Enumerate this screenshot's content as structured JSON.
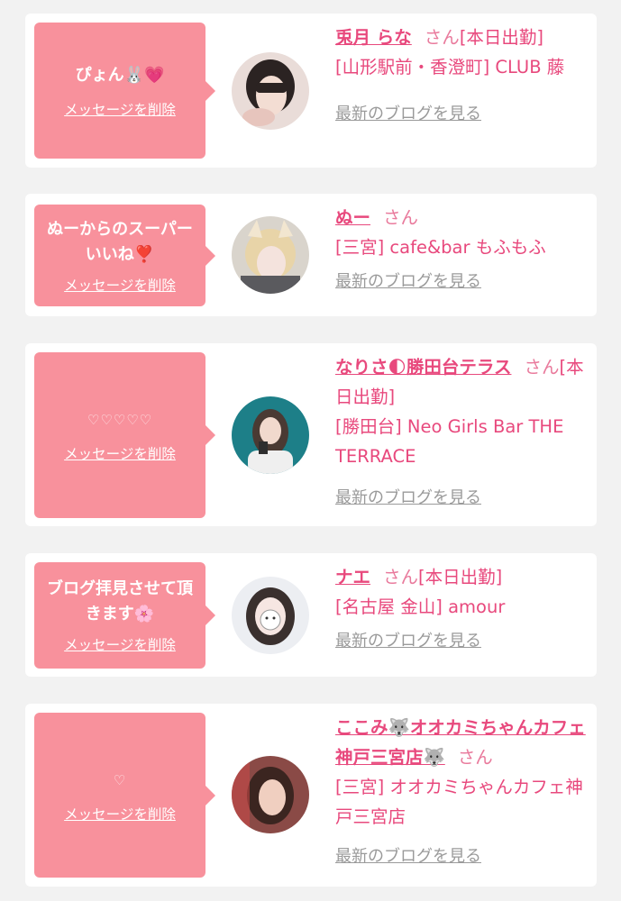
{
  "delete_label": "メッセージを削除",
  "blog_label": "最新のブログを見る",
  "colors": {
    "bubble": "#f8919c",
    "name": "#e8497d",
    "link_gray": "#9a9a9a",
    "background": "#f2f2f2"
  },
  "items": [
    {
      "message": "ぴょん🐰💗",
      "name": "兎月 らな",
      "honorific": "さん",
      "status": "[本日出勤]",
      "shop": "[山形駅前・香澄町] CLUB 藤"
    },
    {
      "message": "ぬーからのスーパーいいね❣️",
      "name": "ぬー",
      "honorific": "さん",
      "status": "",
      "shop": "[三宮] cafe&bar もふもふ"
    },
    {
      "message": "♡♡♡♡♡",
      "name": "なりさ🌓勝田台テラス",
      "honorific": "さん",
      "status": "[本日出勤]",
      "shop": "[勝田台] Neo Girls Bar THE TERRACE"
    },
    {
      "message": "ブログ拝見させて頂きます🌸",
      "name": "ナエ",
      "honorific": "さん",
      "status": "[本日出勤]",
      "shop": "[名古屋 金山] amour"
    },
    {
      "message": "♡",
      "name": "ここみ🐺オオカミちゃんカフェ神戸三宮店🐺",
      "honorific": "さん",
      "status": "",
      "shop": "[三宮] オオカミちゃんカフェ神戸三宮店"
    }
  ]
}
